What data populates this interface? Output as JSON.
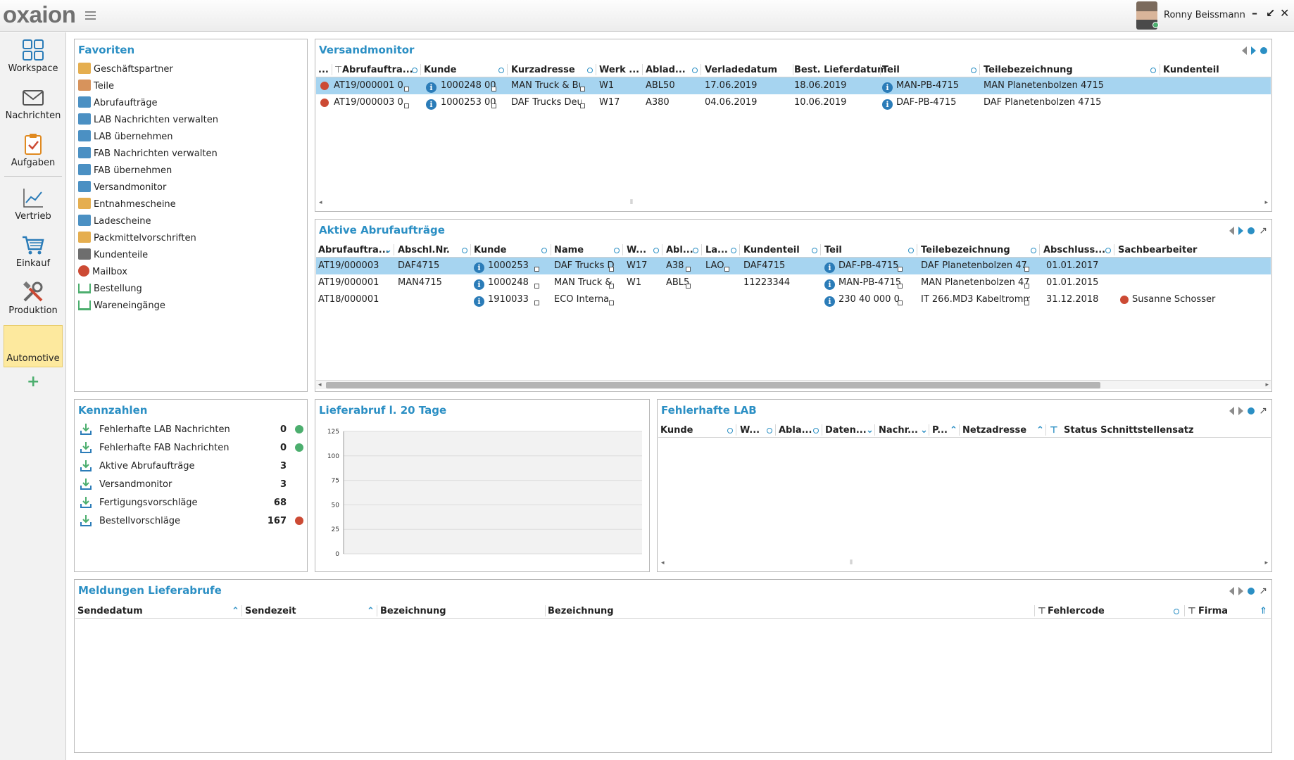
{
  "app": {
    "logo": "oxaion",
    "user_name": "Ronny Beissmann"
  },
  "window_controls": [
    "–",
    "↙",
    "✕"
  ],
  "nav": {
    "items": [
      {
        "label": "Workspace",
        "icon": "workspace-icon"
      },
      {
        "label": "Nachrichten",
        "icon": "mail-icon"
      },
      {
        "label": "Aufgaben",
        "icon": "tasks-icon"
      },
      {
        "label": "Vertrieb",
        "icon": "sales-chart-icon"
      },
      {
        "label": "Einkauf",
        "icon": "shopping-cart-icon"
      },
      {
        "label": "Produktion",
        "icon": "tools-icon"
      },
      {
        "label": "Automotive",
        "icon": ""
      }
    ],
    "add_label": "+"
  },
  "favorites": {
    "title": "Favoriten",
    "items": [
      {
        "label": "Geschäftspartner",
        "icon": "business-partner-icon",
        "color": "#e0a030"
      },
      {
        "label": "Teile",
        "icon": "parts-icon",
        "color": "#d08040"
      },
      {
        "label": "Abrufaufträge",
        "icon": "thumbs-up-icon",
        "color": "#2b7cb8"
      },
      {
        "label": "LAB Nachrichten verwalten",
        "icon": "truck-icon",
        "color": "#2b7cb8"
      },
      {
        "label": "LAB übernehmen",
        "icon": "tree-icon",
        "color": "#2b7cb8"
      },
      {
        "label": "FAB Nachrichten verwalten",
        "icon": "truck-icon",
        "color": "#2b7cb8"
      },
      {
        "label": "FAB übernehmen",
        "icon": "tree-icon",
        "color": "#2b7cb8"
      },
      {
        "label": "Versandmonitor",
        "icon": "cart-icon",
        "color": "#2b7cb8"
      },
      {
        "label": "Entnahmescheine",
        "icon": "person-card-icon",
        "color": "#e0a030"
      },
      {
        "label": "Ladescheine",
        "icon": "loading-truck-icon",
        "color": "#2b7cb8"
      },
      {
        "label": "Packmittelvorschriften",
        "icon": "package-icon",
        "color": "#e0a030"
      },
      {
        "label": "Kundenteile",
        "icon": "briefcase-icon",
        "color": "#555555"
      },
      {
        "label": "Mailbox",
        "icon": "red-circle-icon",
        "color": "#cc4a34"
      },
      {
        "label": "Bestellung",
        "icon": "download-icon",
        "color": "#4cae6e"
      },
      {
        "label": "Wareneingänge",
        "icon": "download-icon",
        "color": "#4cae6e"
      }
    ]
  },
  "versandmonitor": {
    "title": "Versandmonitor",
    "columns": [
      "...",
      "Abrufauftra...",
      "Kunde",
      "Kurzadresse",
      "Werk ...",
      "Ablad...",
      "Verladedatum",
      "Best. Lieferdatum",
      "Teil",
      "Teilebezeichnung",
      "Kundenteil"
    ],
    "rows": [
      {
        "auftrag": "AT19/000001 0",
        "kunde": "1000248 00",
        "kurz": "MAN Truck & Bu",
        "werk": "W1",
        "ablad": "ABL50",
        "verlade": "17.06.2019",
        "liefer": "18.06.2019",
        "teil": "MAN-PB-4715",
        "bez": "MAN Planetenbolzen 4715",
        "kundenteil": ""
      },
      {
        "auftrag": "AT19/000003 0",
        "kunde": "1000253 00",
        "kurz": "DAF Trucks Deu",
        "werk": "W17",
        "ablad": "A380",
        "verlade": "04.06.2019",
        "liefer": "10.06.2019",
        "teil": "DAF-PB-4715",
        "bez": "DAF Planetenbolzen 4715",
        "kundenteil": ""
      }
    ]
  },
  "aktive": {
    "title": "Aktive Abrufaufträge",
    "columns": [
      "Abrufauftra...",
      "Abschl.Nr.",
      "Kunde",
      "Name",
      "W...",
      "Abl...",
      "La...",
      "Kundenteil",
      "Teil",
      "Teilebezeichnung",
      "Abschluss...",
      "Sachbearbeiter"
    ],
    "rows": [
      {
        "auftrag": "AT19/000003",
        "abschl": "DAF4715",
        "kunde": "1000253",
        "name": "DAF Trucks D",
        "w": "W17",
        "abl": "A38",
        "la": "LAO",
        "kundenteil": "DAF4715",
        "teil": "DAF-PB-4715",
        "bez": "DAF Planetenbolzen 47",
        "abschluss": "01.01.2017",
        "sb": ""
      },
      {
        "auftrag": "AT19/000001",
        "abschl": "MAN4715",
        "kunde": "1000248",
        "name": "MAN Truck &",
        "w": "W1",
        "abl": "ABL5",
        "la": "",
        "kundenteil": "11223344",
        "teil": "MAN-PB-4715",
        "bez": "MAN Planetenbolzen 47",
        "abschluss": "01.01.2015",
        "sb": ""
      },
      {
        "auftrag": "AT18/000001",
        "abschl": "",
        "kunde": "1910033",
        "name": "ECO Interna",
        "w": "",
        "abl": "",
        "la": "",
        "kundenteil": "",
        "teil": "230 40 000 0",
        "bez": "IT 266.MD3 Kabeltromm",
        "abschluss": "31.12.2018",
        "sb": "Susanne Schosser"
      }
    ]
  },
  "kennzahlen": {
    "title": "Kennzahlen",
    "items": [
      {
        "label": "Fehlerhafte LAB Nachrichten",
        "value": "0",
        "status": "green"
      },
      {
        "label": "Fehlerhafte FAB Nachrichten",
        "value": "0",
        "status": "green"
      },
      {
        "label": "Aktive Abrufaufträge",
        "value": "3",
        "status": ""
      },
      {
        "label": "Versandmonitor",
        "value": "3",
        "status": ""
      },
      {
        "label": "Fertigungsvorschläge",
        "value": "68",
        "status": ""
      },
      {
        "label": "Bestellvorschläge",
        "value": "167",
        "status": "red"
      }
    ]
  },
  "lieferabruf": {
    "title": "Lieferabruf l. 20 Tage"
  },
  "chart_data": {
    "type": "bar",
    "title": "Lieferabruf l. 20 Tage",
    "categories": [],
    "values": [],
    "ylim": [
      0,
      125
    ],
    "yticks": [
      "125",
      "100",
      "75",
      "50",
      "25",
      "0"
    ],
    "grid": true
  },
  "fehlerhafte_lab": {
    "title": "Fehlerhafte LAB",
    "columns": [
      "Kunde",
      "W...",
      "Abla...",
      "Daten...",
      "Nachr...",
      "P...",
      "Netzadresse",
      "Status Schnittstellensatz"
    ]
  },
  "meldungen": {
    "title": "Meldungen Lieferabrufe",
    "columns": [
      "Sendedatum",
      "Sendezeit",
      "Bezeichnung",
      "Bezeichnung",
      "Fehlercode",
      "Firma"
    ]
  },
  "colors": {
    "accent": "#2b8fc4",
    "selection": "#a6d4f0",
    "active_nav": "#fde99e",
    "status_red": "#cc4a34",
    "status_green": "#4cae6e"
  }
}
